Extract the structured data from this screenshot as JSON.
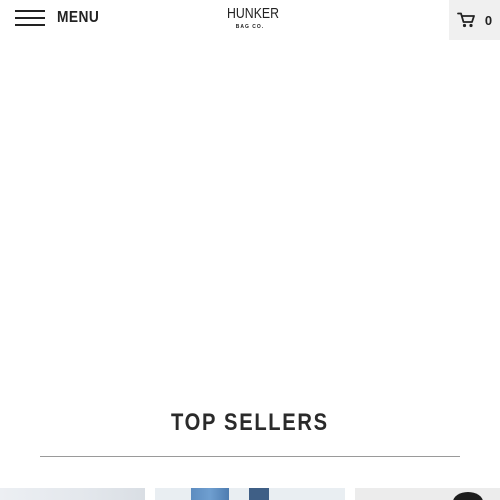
{
  "header": {
    "menu_label": "MENU",
    "logo": {
      "word": "HUNKER",
      "sub": "BAG CO."
    },
    "cart": {
      "count": "0",
      "icon": "cart-icon"
    }
  },
  "sections": {
    "top_sellers": {
      "title": "TOP SELLERS"
    }
  },
  "colors": {
    "background": "#ffffff",
    "text": "#222222",
    "cart_bg": "#f0f0f0",
    "divider": "#9a9a9a"
  }
}
